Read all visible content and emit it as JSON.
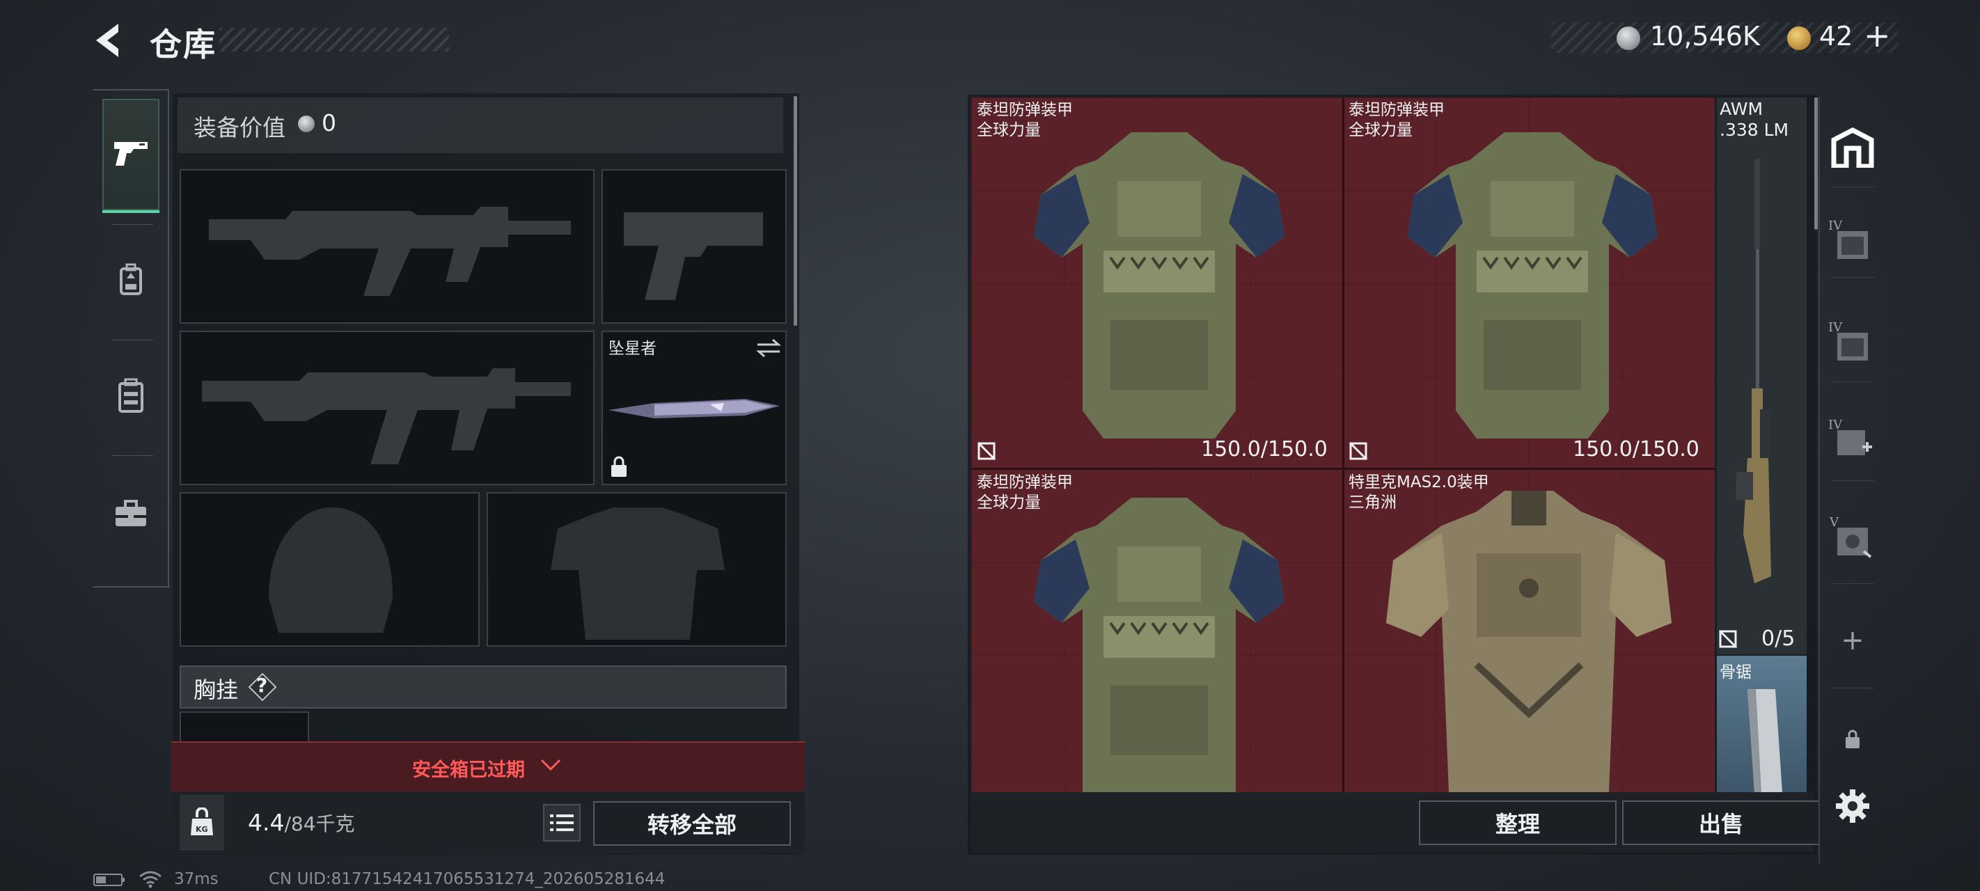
{
  "header": {
    "title": "仓库",
    "silver_amount": "10,546K",
    "gold_amount": "42",
    "gold_plus": "+"
  },
  "left_rail": {
    "tabs": [
      {
        "icon": "pistol-icon",
        "active": true
      },
      {
        "icon": "backpack-icon",
        "active": false
      },
      {
        "icon": "vest-icon",
        "active": false
      },
      {
        "icon": "toolbox-icon",
        "active": false
      }
    ]
  },
  "equipment": {
    "value_label": "装备价值",
    "value": "0",
    "melee_name": "坠星者",
    "chest_rig_label": "胸挂",
    "chest_rig_help": "?"
  },
  "safe_box": {
    "expired_text": "安全箱已过期"
  },
  "weight": {
    "current": "4.4",
    "max_unit": "/84千克",
    "kg_label": "KG"
  },
  "buttons": {
    "transfer_all": "转移全部",
    "sort": "整理",
    "sell": "出售"
  },
  "storage": {
    "items": [
      {
        "name": "泰坦防弹装甲",
        "subtitle": "全球力量",
        "durability": "150.0/150.0"
      },
      {
        "name": "泰坦防弹装甲",
        "subtitle": "全球力量",
        "durability": "150.0/150.0"
      },
      {
        "name": "泰坦防弹装甲",
        "subtitle": "全球力量",
        "durability": ""
      },
      {
        "name": "特里克MAS2.0装甲",
        "subtitle": "三角洲",
        "durability": ""
      }
    ],
    "awm": {
      "name": "AWM",
      "caliber": ".338 LM",
      "count": "0/5"
    },
    "saw": {
      "name": "骨锯"
    }
  },
  "right_rail": {
    "items": [
      "home-storage-icon",
      "storage-iv-a-icon",
      "storage-iv-b-icon",
      "storage-iv-add-icon",
      "storage-v-icon",
      "add-icon",
      "lock-icon",
      "settings-icon"
    ],
    "tier_labels": [
      "IV",
      "IV",
      "IV",
      "V"
    ],
    "add_symbol": "+"
  },
  "status": {
    "ping": "37ms",
    "uid": "CN UID:81771542417065531274_202605281644"
  },
  "colors": {
    "grid_bg": "#5a2228",
    "accent_green": "#5fd3a8",
    "warning_red": "#ff5a5a",
    "panel_dark": "#1e2226"
  }
}
